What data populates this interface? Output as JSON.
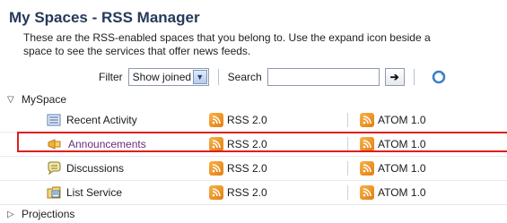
{
  "header": {
    "title": "My Spaces - RSS Manager",
    "description_line1": "These are the RSS-enabled spaces that you belong to. Use the expand icon beside a",
    "description_line2": "space to see the services that offer news feeds."
  },
  "filter": {
    "label": "Filter",
    "selected": "Show joined",
    "search_label": "Search",
    "search_value": ""
  },
  "tree": {
    "group1": {
      "label": "MySpace",
      "expanded": true
    },
    "items": [
      {
        "name": "Recent Activity",
        "rss": "RSS 2.0",
        "atom": "ATOM 1.0",
        "icon": "recent-activity-icon"
      },
      {
        "name": "Announcements",
        "rss": "RSS 2.0",
        "atom": "ATOM 1.0",
        "icon": "announcement-icon"
      },
      {
        "name": "Discussions",
        "rss": "RSS 2.0",
        "atom": "ATOM 1.0",
        "icon": "discussion-icon"
      },
      {
        "name": "List Service",
        "rss": "RSS 2.0",
        "atom": "ATOM 1.0",
        "icon": "list-icon"
      }
    ],
    "group2": {
      "label": "Projections",
      "expanded": false
    }
  },
  "colors": {
    "title": "#253a5a",
    "highlight": "#dd1f1f",
    "feed": "#e47d12"
  }
}
